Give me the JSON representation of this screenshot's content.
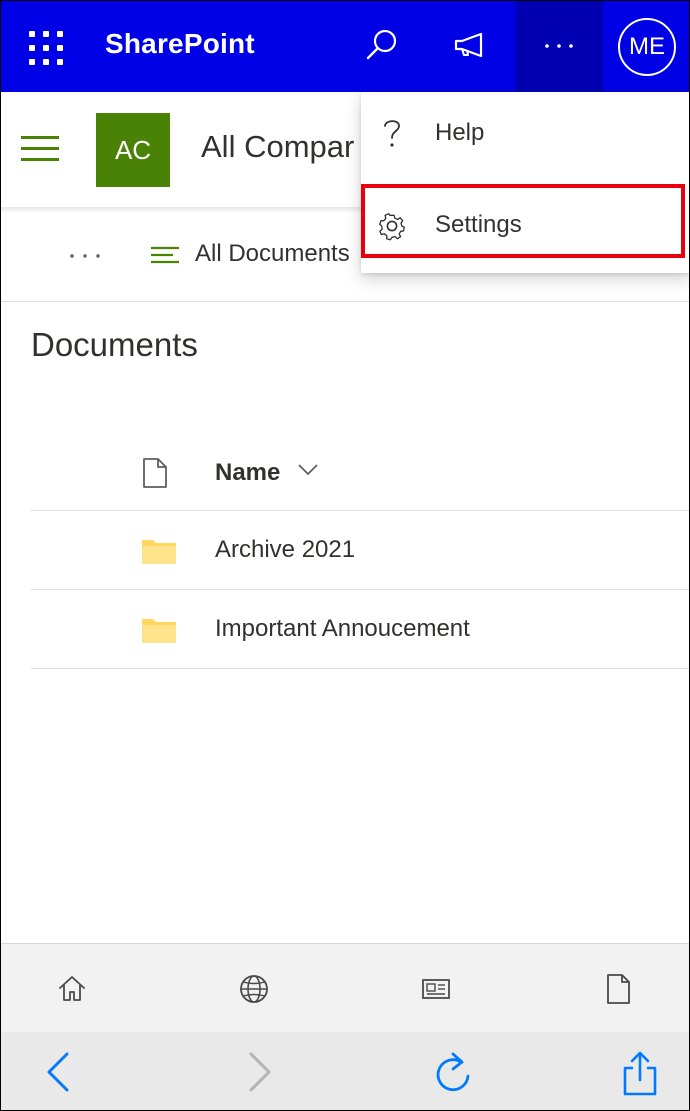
{
  "suitebar": {
    "brand": "SharePoint",
    "avatar_initials": "ME",
    "color": "#0000e6",
    "active_color": "#0000b3"
  },
  "site": {
    "logo_initials": "AC",
    "title": "All Compar",
    "logo_color": "#498205"
  },
  "commandbar": {
    "view_label": "All Documents"
  },
  "menu": {
    "items": [
      {
        "label": "Help",
        "icon": "question-icon"
      },
      {
        "label": "Settings",
        "icon": "gear-icon",
        "highlighted": true
      }
    ],
    "highlight_color": "#e8000f"
  },
  "library": {
    "title": "Documents",
    "column_name": "Name",
    "rows": [
      {
        "name": "Archive 2021",
        "icon": "folder-icon"
      },
      {
        "name": "Important Annoucement",
        "icon": "folder-icon"
      }
    ],
    "folder_color": "#ffd75e"
  },
  "browser": {
    "bookmarks_icons": [
      "home-icon",
      "globe-icon",
      "news-icon",
      "page-icon"
    ],
    "nav_icons": [
      "back-icon",
      "forward-icon",
      "reload-icon",
      "share-icon"
    ],
    "accent_color": "#007aff"
  }
}
